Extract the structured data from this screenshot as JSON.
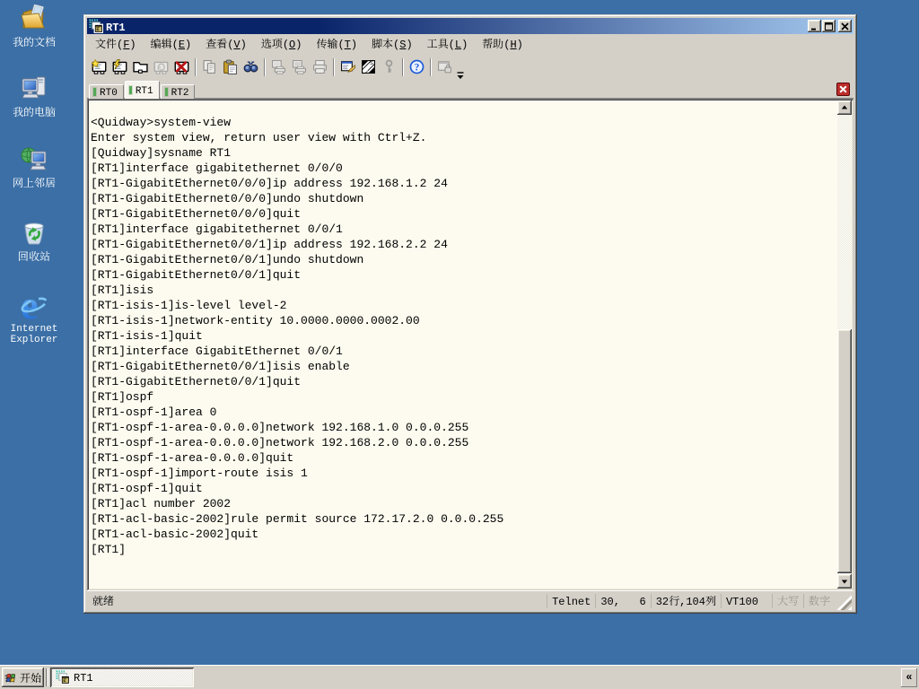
{
  "colors": {
    "desktop": "#3B6FA6",
    "caption_start": "#0A246A",
    "caption_end": "#A6CAF0",
    "button_face": "#D4D0C8",
    "terminal_bg": "#FDFBEF",
    "terminal_fg": "#000000",
    "tab_indicator_green": "#55A855",
    "tab_close_red": "#C62E2E",
    "desktop_label_fg": "#FFFFFF"
  },
  "desktop": {
    "icons": [
      {
        "id": "my-documents",
        "label": "我的文档"
      },
      {
        "id": "my-computer",
        "label": "我的电脑"
      },
      {
        "id": "network-places",
        "label": "网上邻居"
      },
      {
        "id": "recycle-bin",
        "label": "回收站"
      },
      {
        "id": "internet-explorer",
        "label": "Internet\nExplorer"
      }
    ]
  },
  "window": {
    "title": "RT1",
    "window_buttons": {
      "minimize": "minimize",
      "maximize": "maximize",
      "close": "close"
    },
    "menu": {
      "items": [
        {
          "label": "文件(F)"
        },
        {
          "label": "编辑(E)"
        },
        {
          "label": "查看(V)"
        },
        {
          "label": "选项(O)"
        },
        {
          "label": "传输(T)"
        },
        {
          "label": "脚本(S)"
        },
        {
          "label": "工具(L)"
        },
        {
          "label": "帮助(H)"
        }
      ]
    },
    "toolbar": {
      "buttons": [
        {
          "icon": "quick-connect",
          "enabled": true,
          "sep": false
        },
        {
          "icon": "connect",
          "enabled": true,
          "sep": false
        },
        {
          "icon": "connect-in-tab",
          "enabled": true,
          "sep": false
        },
        {
          "icon": "reconnect",
          "enabled": false,
          "sep": false
        },
        {
          "icon": "disconnect",
          "enabled": true,
          "sep": true
        },
        {
          "icon": "copy",
          "enabled": false,
          "sep": false
        },
        {
          "icon": "paste",
          "enabled": true,
          "sep": false
        },
        {
          "icon": "find",
          "enabled": true,
          "sep": true
        },
        {
          "icon": "print-screen",
          "enabled": false,
          "sep": false
        },
        {
          "icon": "print-selection",
          "enabled": false,
          "sep": false
        },
        {
          "icon": "printer",
          "enabled": false,
          "sep": true
        },
        {
          "icon": "session-options",
          "enabled": true,
          "sep": false
        },
        {
          "icon": "keymap-editor",
          "enabled": true,
          "sep": false
        },
        {
          "icon": "key-agent",
          "enabled": false,
          "sep": true
        },
        {
          "icon": "help",
          "enabled": true,
          "sep": true
        },
        {
          "icon": "app-window",
          "enabled": false,
          "sep": false
        }
      ],
      "overflow": "toolbar-overflow"
    },
    "tabs": {
      "items": [
        {
          "label": "RT0",
          "active": false,
          "connected": true
        },
        {
          "label": "RT1",
          "active": true,
          "connected": true
        },
        {
          "label": "RT2",
          "active": false,
          "connected": true
        }
      ]
    },
    "terminal": {
      "lines": [
        "<Quidway>system-view",
        "Enter system view, return user view with Ctrl+Z.",
        "[Quidway]sysname RT1",
        "[RT1]interface gigabitethernet 0/0/0",
        "[RT1-GigabitEthernet0/0/0]ip address 192.168.1.2 24",
        "[RT1-GigabitEthernet0/0/0]undo shutdown",
        "[RT1-GigabitEthernet0/0/0]quit",
        "[RT1]interface gigabitethernet 0/0/1",
        "[RT1-GigabitEthernet0/0/1]ip address 192.168.2.2 24",
        "[RT1-GigabitEthernet0/0/1]undo shutdown",
        "[RT1-GigabitEthernet0/0/1]quit",
        "[RT1]isis",
        "[RT1-isis-1]is-level level-2",
        "[RT1-isis-1]network-entity 10.0000.0000.0002.00",
        "[RT1-isis-1]quit",
        "[RT1]interface GigabitEthernet 0/0/1",
        "[RT1-GigabitEthernet0/0/1]isis enable",
        "[RT1-GigabitEthernet0/0/1]quit",
        "[RT1]ospf",
        "[RT1-ospf-1]area 0",
        "[RT1-ospf-1-area-0.0.0.0]network 192.168.1.0 0.0.0.255",
        "[RT1-ospf-1-area-0.0.0.0]network 192.168.2.0 0.0.0.255",
        "[RT1-ospf-1-area-0.0.0.0]quit",
        "[RT1-ospf-1]import-route isis 1",
        "[RT1-ospf-1]quit",
        "[RT1]acl number 2002",
        "[RT1-acl-basic-2002]rule permit source 172.17.2.0 0.0.0.255",
        "[RT1-acl-basic-2002]quit",
        "[RT1]"
      ]
    },
    "status": {
      "ready": "就绪",
      "panes": [
        {
          "label": "Telnet",
          "dim": false
        },
        {
          "label": "30,   6",
          "dim": false
        },
        {
          "label": "32行,104列",
          "dim": false
        },
        {
          "label": "VT100",
          "dim": false
        },
        {
          "label": "大写",
          "dim": true,
          "gap": true
        },
        {
          "label": "数字",
          "dim": true
        }
      ]
    }
  },
  "taskbar": {
    "start_label": "开始",
    "tasks": [
      {
        "label": "RT1",
        "active": true
      }
    ],
    "tray_chevron": "«"
  }
}
